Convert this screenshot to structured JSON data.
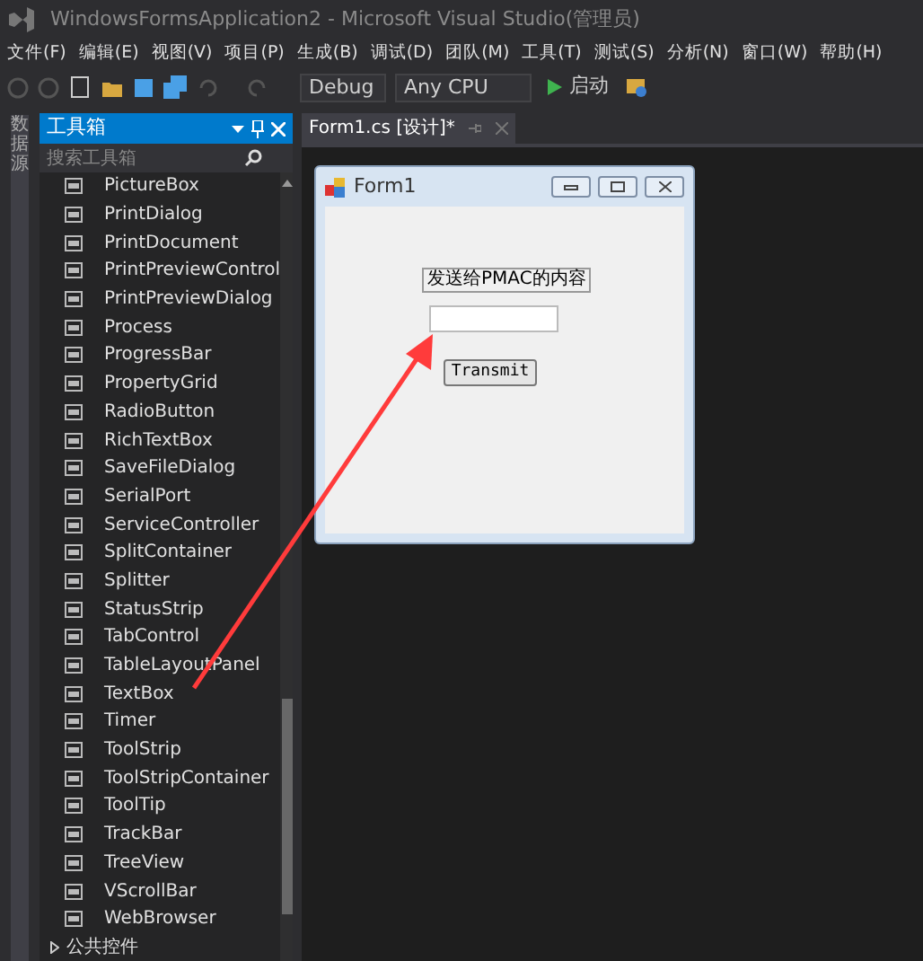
{
  "window": {
    "title": "WindowsFormsApplication2 - Microsoft Visual Studio(管理员)"
  },
  "menu": [
    "文件(F)",
    "编辑(E)",
    "视图(V)",
    "项目(P)",
    "生成(B)",
    "调试(D)",
    "团队(M)",
    "工具(T)",
    "测试(S)",
    "分析(N)",
    "窗口(W)",
    "帮助(H)"
  ],
  "toolbar": {
    "configuration": "Debug",
    "platform": "Any CPU",
    "start": "启动"
  },
  "side_tab": "数据源",
  "toolbox": {
    "title": "工具箱",
    "search": {
      "placeholder": "搜索工具箱"
    },
    "items": [
      "PictureBox",
      "PrintDialog",
      "PrintDocument",
      "PrintPreviewControl",
      "PrintPreviewDialog",
      "Process",
      "ProgressBar",
      "PropertyGrid",
      "RadioButton",
      "RichTextBox",
      "SaveFileDialog",
      "SerialPort",
      "ServiceController",
      "SplitContainer",
      "Splitter",
      "StatusStrip",
      "TabControl",
      "TableLayoutPanel",
      "TextBox",
      "Timer",
      "ToolStrip",
      "ToolStripContainer",
      "ToolTip",
      "TrackBar",
      "TreeView",
      "VScrollBar",
      "WebBrowser"
    ],
    "groups": [
      {
        "label": "公共控件",
        "expanded": false
      }
    ]
  },
  "document_tabs": [
    {
      "label": "Form1.cs [设计]*",
      "selected": true
    }
  ],
  "form": {
    "title": "Form1",
    "controls": [
      {
        "kind": "label",
        "text": "发送给PMAC的内容"
      },
      {
        "kind": "textbox"
      },
      {
        "kind": "button",
        "text": "Transmit"
      }
    ]
  },
  "annotations": [
    {
      "kind": "arrow"
    }
  ]
}
